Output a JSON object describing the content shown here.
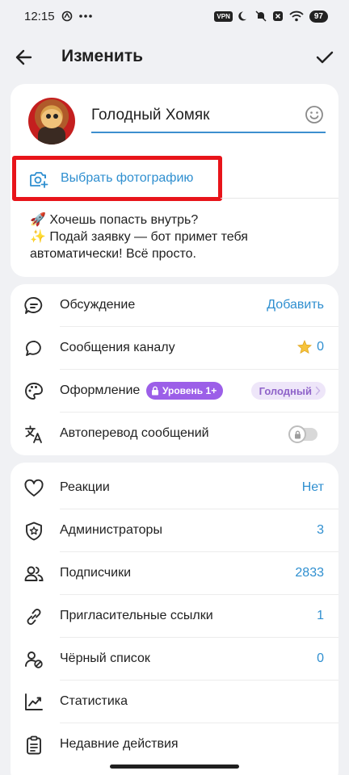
{
  "status_bar": {
    "time": "12:15",
    "vpn": "VPN",
    "battery": "97"
  },
  "header": {
    "title": "Изменить"
  },
  "profile": {
    "name": "Голодный Хомяк",
    "choose_photo": "Выбрать фотографию",
    "description_line1": "🚀 Хочешь попасть внутрь?",
    "description_line2": "✨ Подай заявку — бот примет тебя автоматически! Всё просто."
  },
  "settings": {
    "discussion": {
      "label": "Обсуждение",
      "value": "Добавить"
    },
    "channel_messages": {
      "label": "Сообщения каналу",
      "value": "0"
    },
    "appearance": {
      "label": "Оформление",
      "badge": "Уровень 1+",
      "theme": "Голодный"
    },
    "auto_translate": {
      "label": "Автоперевод сообщений"
    }
  },
  "manage": {
    "reactions": {
      "label": "Реакции",
      "value": "Нет"
    },
    "admins": {
      "label": "Администраторы",
      "value": "3"
    },
    "subscribers": {
      "label": "Подписчики",
      "value": "2833"
    },
    "invite_links": {
      "label": "Пригласительные ссылки",
      "value": "1"
    },
    "blacklist": {
      "label": "Чёрный список",
      "value": "0"
    },
    "statistics": {
      "label": "Статистика"
    },
    "recent_actions": {
      "label": "Недавние действия"
    }
  },
  "colors": {
    "accent": "#2f8fd0",
    "highlight": "#e8141a",
    "level_badge": "#9c5fe8"
  }
}
